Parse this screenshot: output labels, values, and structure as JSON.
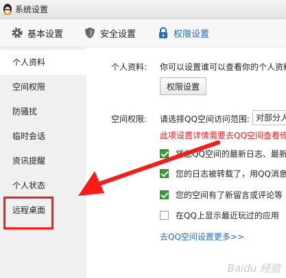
{
  "window": {
    "title": "系统设置"
  },
  "topnav": {
    "tabs": [
      {
        "label": "基本设置",
        "icon": "gear-icon"
      },
      {
        "label": "安全设置",
        "icon": "shield-icon"
      },
      {
        "label": "权限设置",
        "icon": "lock-icon",
        "active": true
      }
    ]
  },
  "sidebar": {
    "items": [
      {
        "label": "个人资料",
        "active": true
      },
      {
        "label": "空间权限"
      },
      {
        "label": "防骚扰"
      },
      {
        "label": "临时会话"
      },
      {
        "label": "资讯提醒"
      },
      {
        "label": "个人状态"
      },
      {
        "label": "远程桌面",
        "highlighted": true
      }
    ]
  },
  "main": {
    "profile": {
      "label": "个人资料:",
      "desc": "你可以设置谁可以查看你的个人资料",
      "button": "权限设置"
    },
    "space": {
      "label": "空间权限:",
      "prompt": "请选择QQ空间访问范围:",
      "select_value": "对部分人",
      "note": "此项设置详情需要去QQ空间查看修改",
      "options": [
        {
          "label": "将您QQ空间的最新日志、最新",
          "checked": true
        },
        {
          "label": "您的日志被转载了，用QQ消息",
          "checked": true
        },
        {
          "label": "您的空间有了新留言或评论等",
          "checked": true
        },
        {
          "label": "在QQ上显示最近玩过的应用",
          "checked": false
        }
      ],
      "more_link": "去QQ空间设置更多>>"
    }
  },
  "watermark": "Baidu 经验",
  "colors": {
    "accent": "#1e6fbf",
    "annotation": "#ff1a1a",
    "check": "#2f9e2f"
  }
}
